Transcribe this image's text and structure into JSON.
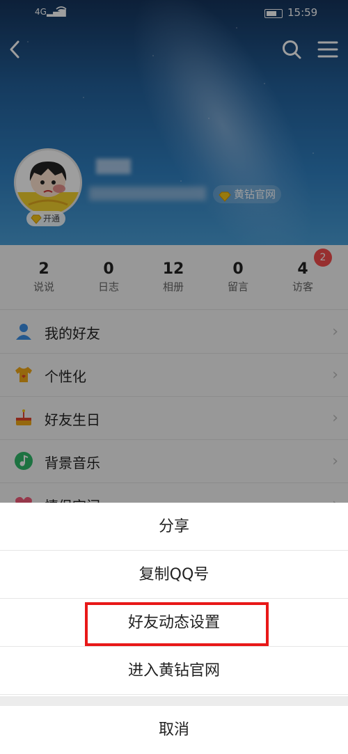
{
  "status_bar": {
    "signal": "4G",
    "time": "15:59"
  },
  "header": {
    "vip_link_label": "黄钻官网",
    "open_badge_label": "开通"
  },
  "stats": [
    {
      "value": "2",
      "label": "说说"
    },
    {
      "value": "0",
      "label": "日志"
    },
    {
      "value": "12",
      "label": "相册"
    },
    {
      "value": "0",
      "label": "留言"
    },
    {
      "value": "4",
      "label": "访客"
    }
  ],
  "visitor_badge": "2",
  "menu": {
    "items": [
      {
        "label": "我的好友",
        "icon": "user-icon"
      },
      {
        "label": "个性化",
        "icon": "tshirt-icon"
      },
      {
        "label": "好友生日",
        "icon": "cake-icon"
      },
      {
        "label": "背景音乐",
        "icon": "music-icon"
      },
      {
        "label": "情侣空间",
        "icon": "heart-icon"
      }
    ]
  },
  "action_sheet": {
    "items": [
      "分享",
      "复制QQ号",
      "好友动态设置",
      "进入黄钻官网"
    ],
    "cancel": "取消"
  },
  "colors": {
    "highlight_border": "#e81818",
    "badge": "#f44d4d"
  }
}
